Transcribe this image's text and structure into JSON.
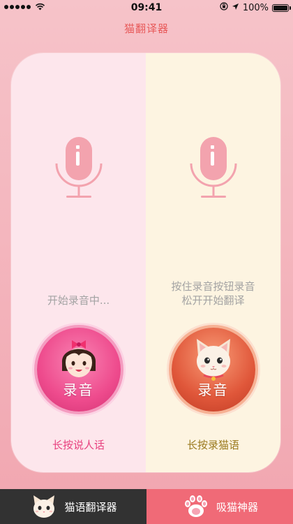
{
  "status_bar": {
    "time": "09:41",
    "battery": "100%"
  },
  "header": {
    "title": "猫翻译器"
  },
  "left_panel": {
    "hint": "开始录音中...",
    "record_label": "录音",
    "hold_text": "长按说人话"
  },
  "right_panel": {
    "hint_line1": "按住录音按钮录音",
    "hint_line2": "松开开始翻译",
    "record_label": "录音",
    "hold_text": "长按录猫语"
  },
  "tabs": [
    {
      "label": "猫语翻译器",
      "icon": "cat-face-icon"
    },
    {
      "label": "吸猫神器",
      "icon": "paw-icon"
    }
  ],
  "colors": {
    "title": "#e85a5a",
    "left_panel_bg": "#fde6ec",
    "right_panel_bg": "#fdf4e1",
    "tab_active_bg": "#323232",
    "tab_inactive_bg": "#f06a77"
  }
}
